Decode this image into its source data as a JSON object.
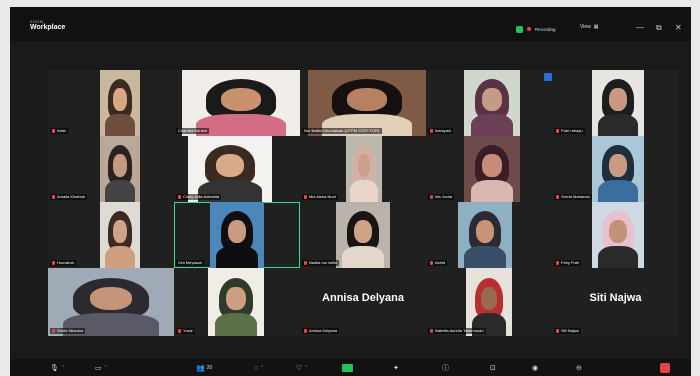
{
  "window": {
    "brand_top": "ZOOM",
    "brand_main": "Workplace",
    "recording_label": "Recording",
    "view_label": "View",
    "controls": [
      "—",
      "⧉",
      "✕"
    ]
  },
  "colors": {
    "recording": "#e64545",
    "security": "#23c552",
    "active_speaker": "#3ddc84",
    "muted_mic": "#e64545"
  },
  "participants": [
    {
      "name": "irdah",
      "muted": true
    },
    {
      "name": "Chandra Kentoh",
      "muted": false
    },
    {
      "name": "Nur Balkis Khumaisah (UTPM STEP FOR)",
      "muted": false
    },
    {
      "name": "ismayani",
      "muted": true
    },
    {
      "name": "Putri rahayu",
      "muted": true
    },
    {
      "name": "Amalia Khairiah",
      "muted": true
    },
    {
      "name": "Cindy Julia Antonela",
      "muted": true
    },
    {
      "name": "Mia Aisha Nuni",
      "muted": true
    },
    {
      "name": "Ida Juvita",
      "muted": true
    },
    {
      "name": "Selvia Maharani",
      "muted": true
    },
    {
      "name": "Humairoh",
      "muted": true
    },
    {
      "name": "Ora Meyasari",
      "muted": false
    },
    {
      "name": "Nadila nur latifa",
      "muted": true
    },
    {
      "name": "Astrid",
      "muted": true
    },
    {
      "name": "Feby Putri",
      "muted": true
    },
    {
      "name": "Shofa Nirwana",
      "muted": true
    },
    {
      "name": "Yuniz",
      "muted": true
    },
    {
      "name": "Annisa Delyana",
      "muted": true,
      "display_name": "Annisa Delyana"
    },
    {
      "name": "Nabella Aurelia Tasemunari",
      "muted": true
    },
    {
      "name": "Siti Najwa",
      "muted": true,
      "display_name": "Siti Najwa"
    }
  ],
  "active_speaker": "Ora Meyasari",
  "toolbar": {
    "items": [
      "mic-icon",
      "video-icon",
      "participants-icon",
      "chat-icon",
      "reactions-icon",
      "share-screen-icon",
      "apps-icon",
      "info-icon",
      "rooms-icon",
      "record-icon",
      "more-icon",
      "leave-icon"
    ],
    "participant_count": "20"
  }
}
